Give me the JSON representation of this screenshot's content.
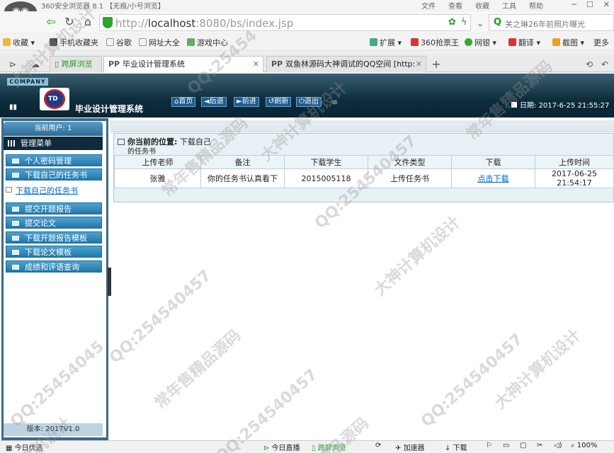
{
  "browser": {
    "title": "360安全浏览器 8.1 【无痕/小号浏览】",
    "menu": [
      "文件",
      "查看",
      "收藏",
      "工具",
      "帮助"
    ],
    "url_host": "localhost",
    "url_rest": ":8080/bs/index.jsp",
    "url_prefix": "http://",
    "search_text": "关之琳26年前照片曝光",
    "bookmarks": [
      "收藏",
      "手机收藏夹",
      "谷歌",
      "网址大全",
      "游戏中心"
    ],
    "right_tools": [
      "扩展",
      "360抢票王",
      "网银",
      "翻译",
      "截图",
      "更多"
    ],
    "tabs": [
      "跨屏浏览",
      "毕业设计管理系统",
      "双鱼林源码大神调试的QQ空间 [http:"
    ],
    "status": {
      "left": "今日优选",
      "items": [
        "今日直播",
        "跨屏浏览",
        "加速器",
        "下载"
      ],
      "zoom": "100%"
    }
  },
  "app": {
    "company": "COMPANY",
    "logo_text": "TD",
    "system_name": "毕业设计管理系统",
    "header_buttons": [
      "首页",
      "后退",
      "前进",
      "刷新",
      "退出"
    ],
    "date_label": "日期:",
    "date_value": "2017-6-25 21:55:27",
    "current_user": "当前用户: 1",
    "menu_title": "管理菜单",
    "menu_items": [
      "个人密码管理",
      "下载自己的任务书",
      "提交开题报告",
      "提交论文",
      "下载开题报告模板",
      "下载论文模板",
      "成绩和评语查询"
    ],
    "submenu_item": "下载自己的任务书",
    "version": "版本: 2017V1.0",
    "location_label": "你当前的位置:",
    "location_value": "下载自己",
    "location_sub": "的任务书",
    "table": {
      "headers": [
        "上传老师",
        "备注",
        "下载学生",
        "文件类型",
        "下载",
        "上传时间"
      ],
      "rows": [
        [
          "张雅",
          "你的任务书认真看下",
          "2015005118",
          "上传任务书",
          "点击下载",
          "2017-06-25 21:54:17"
        ]
      ]
    }
  },
  "watermarks": [
    "QQ:25454045",
    "大神计算机设计",
    "常年售精品源码",
    "QQ:254540457",
    "大神计算机设计",
    "QQ:254540457",
    "常年售精品源码",
    "QQ:254540457",
    "大神计算机设计",
    "QQ:254540457",
    "常年售精品源码",
    "大神计算机设计",
    "QQ:25454",
    "算机设计",
    "精品源码"
  ],
  "colors": {
    "header": "#0d2c3c",
    "menu_item": "#2a85b8",
    "link": "#0066cc"
  }
}
